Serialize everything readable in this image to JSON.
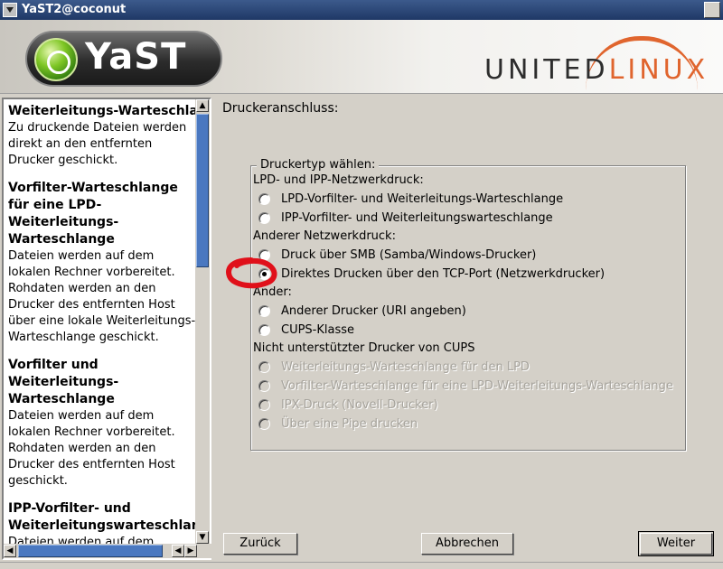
{
  "window": {
    "title": "YaST2@coconut"
  },
  "banner": {
    "yast_text": "YaST",
    "united": "UNITED",
    "linux": "LINUX"
  },
  "help": {
    "sections": [
      {
        "title": "Weiterleitungs-Warteschlange für den LPD:",
        "text": "Zu druckende Dateien werden direkt an den entfernten Drucker geschickt."
      },
      {
        "title": "Vorfilter-Warteschlange für eine LPD-Weiterleitungs-Warteschlange",
        "text": "Dateien werden auf dem lokalen Rechner vorbereitet. Rohdaten werden an den Drucker des entfernten Host über eine lokale Weiterleitungs-Warteschlange geschickt."
      },
      {
        "title": "Vorfilter und Weiterleitungs-Warteschlange",
        "text": "Dateien werden auf dem lokalen Rechner vorbereitet. Rohdaten werden an den Drucker des entfernten Host geschickt."
      },
      {
        "title": "IPP-Vorfilter- und Weiterleitungswarteschlange",
        "text": "Dateien werden auf dem lokalen Rechner vorbereitet und"
      }
    ]
  },
  "main": {
    "title": "Druckeranschluss:",
    "group_title": "Druckertyp wählen:",
    "sections": {
      "lpd_ipp": "LPD- und IPP-Netzwerkdruck:",
      "other_net": "Anderer Netzwerkdruck:",
      "other": "Ander:",
      "unsupported": "Nicht unterstützter Drucker von CUPS"
    },
    "options": [
      "LPD-Vorfilter- und Weiterleitungs-Warteschlange",
      "IPP-Vorfilter- und Weiterleitungswarteschlange",
      "Druck über SMB (Samba/Windows-Drucker)",
      "Direktes Drucken über den TCP-Port (Netzwerkdrucker)",
      "Anderer Drucker (URI angeben)",
      "CUPS-Klasse",
      "Weiterleitungs-Warteschlange für den LPD",
      "Vorfilter-Warteschlange für eine LPD-Weiterleitungs-Warteschlange",
      "IPX-Druck (Novell-Drucker)",
      "Über eine Pipe drucken"
    ],
    "selected_option": "Direktes Drucken über den TCP-Port (Netzwerkdrucker)"
  },
  "buttons": {
    "back": "Zurück",
    "abort": "Abbrechen",
    "next": "Weiter"
  },
  "colors": {
    "accent": "#e0652e",
    "scroll_thumb": "#4a78c0",
    "annotation": "#e0101a"
  }
}
